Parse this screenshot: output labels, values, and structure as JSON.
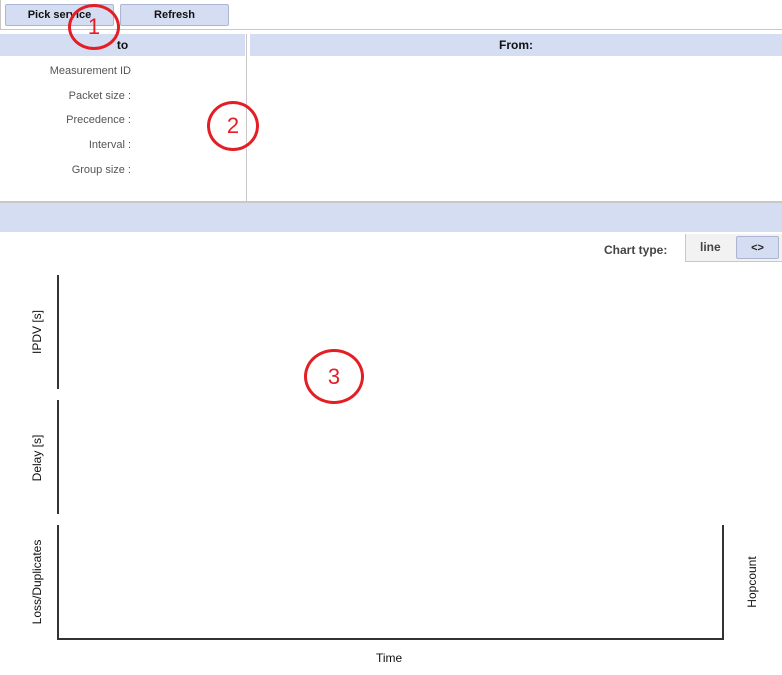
{
  "toolbar": {
    "pick_service_label": "Pick service",
    "refresh_label": "Refresh"
  },
  "details_panel": {
    "header": "to",
    "fields": [
      {
        "label": "Measurement ID"
      },
      {
        "label": "Packet size :"
      },
      {
        "label": "Precedence :"
      },
      {
        "label": "Interval :"
      },
      {
        "label": "Group size :"
      }
    ]
  },
  "from_panel": {
    "header": "From:"
  },
  "chart_controls": {
    "chart_type_label": "Chart type:",
    "chart_type_value": "line",
    "toggle_label": "<>"
  },
  "chart_data": [
    {
      "type": "line",
      "ylabel": "IPDV [s]"
    },
    {
      "type": "line",
      "ylabel": "Delay [s]"
    },
    {
      "type": "line",
      "ylabel": "Loss/Duplicates",
      "y2label": "Hopcount",
      "xlabel": "Time"
    }
  ],
  "annotations": {
    "marker_1": "1",
    "marker_2": "2",
    "marker_3": "3",
    "color": "#e31e24"
  }
}
